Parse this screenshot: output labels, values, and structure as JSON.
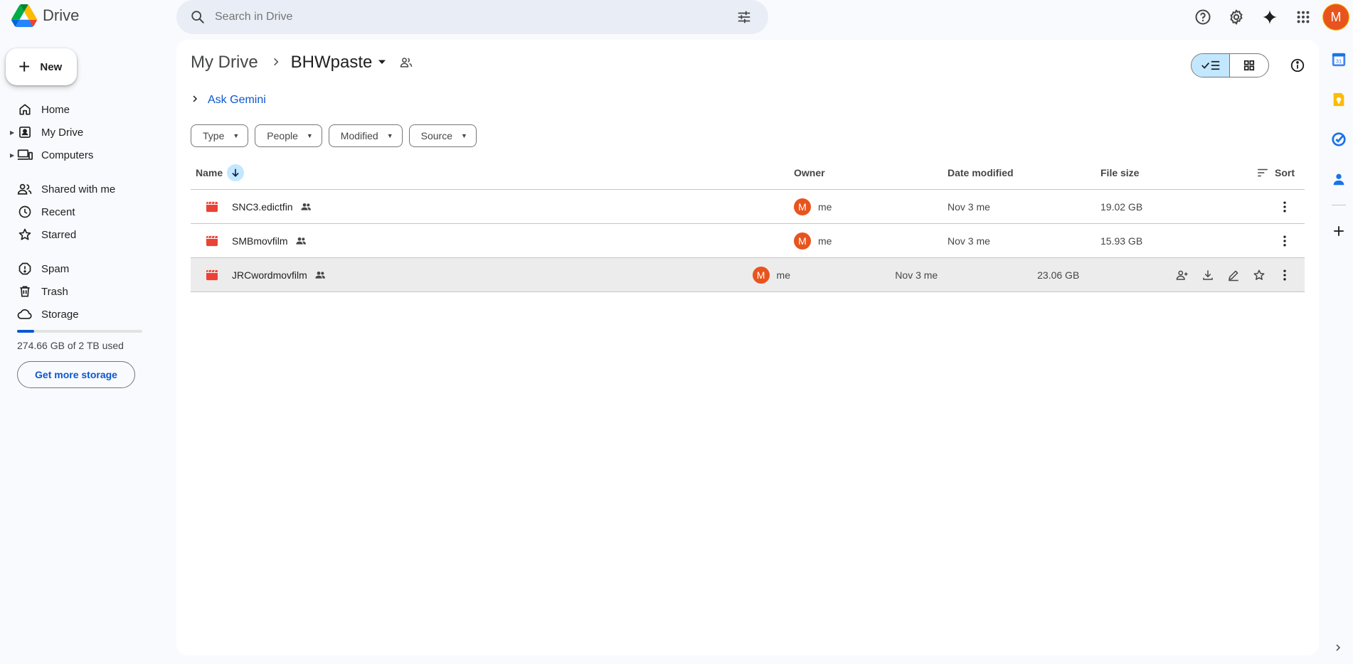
{
  "app": {
    "name": "Drive"
  },
  "search": {
    "placeholder": "Search in Drive"
  },
  "sidebar": {
    "new_label": "New",
    "items": [
      {
        "label": "Home"
      },
      {
        "label": "My Drive"
      },
      {
        "label": "Computers"
      },
      {
        "label": "Shared with me"
      },
      {
        "label": "Recent"
      },
      {
        "label": "Starred"
      },
      {
        "label": "Spam"
      },
      {
        "label": "Trash"
      },
      {
        "label": "Storage"
      }
    ],
    "storage_text": "274.66 GB of 2 TB used",
    "storage_fraction": 0.134,
    "storage_button": "Get more storage"
  },
  "user": {
    "initial": "M"
  },
  "breadcrumb": {
    "root": "My Drive",
    "current": "BHWpaste"
  },
  "ask_gemini": "Ask Gemini",
  "filters": [
    "Type",
    "People",
    "Modified",
    "Source"
  ],
  "table": {
    "headers": {
      "name": "Name",
      "owner": "Owner",
      "date": "Date modified",
      "size": "File size",
      "sort": "Sort"
    },
    "rows": [
      {
        "name": "SNC3.edictfin",
        "owner": "me",
        "owner_initial": "M",
        "date": "Nov 3 me",
        "size": "19.02 GB"
      },
      {
        "name": "SMBmovfilm",
        "owner": "me",
        "owner_initial": "M",
        "date": "Nov 3 me",
        "size": "15.93 GB"
      },
      {
        "name": "JRCwordmovfilm",
        "owner": "me",
        "owner_initial": "M",
        "date": "Nov 3 me",
        "size": "23.06 GB"
      }
    ]
  },
  "colors": {
    "accent": "#0b57d0",
    "selected": "#c2e7ff",
    "avatar": "#e8541e",
    "file_icon": "#ea4335"
  }
}
